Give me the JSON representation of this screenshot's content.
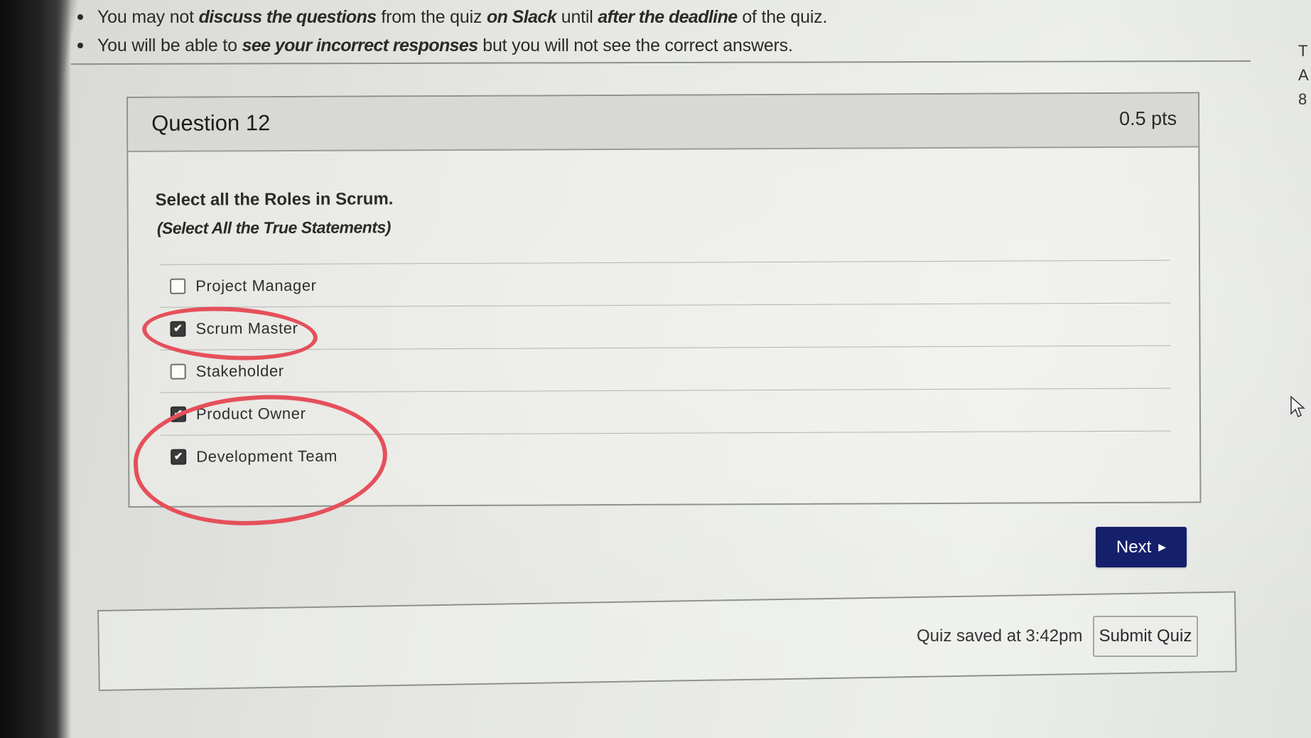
{
  "instructions": [
    {
      "parts": [
        {
          "t": "You may not ",
          "em": false
        },
        {
          "t": "discuss the questions",
          "em": true
        },
        {
          "t": " from the quiz ",
          "em": false
        },
        {
          "t": "on Slack",
          "em": true
        },
        {
          "t": " until ",
          "em": false
        },
        {
          "t": "after the deadline",
          "em": true
        },
        {
          "t": " of the quiz.",
          "em": false
        }
      ]
    },
    {
      "parts": [
        {
          "t": "You will be able to ",
          "em": false
        },
        {
          "t": "see your incorrect responses",
          "em": true
        },
        {
          "t": " but you will not see the correct answers.",
          "em": false
        }
      ]
    }
  ],
  "question": {
    "title": "Question 12",
    "points": "0.5 pts",
    "text": "Select all the Roles in Scrum.",
    "note": "(Select All the True Statements)",
    "answers": [
      {
        "label": "Project Manager",
        "checked": false
      },
      {
        "label": "Scrum Master",
        "checked": true
      },
      {
        "label": "Stakeholder",
        "checked": false
      },
      {
        "label": "Product Owner",
        "checked": true
      },
      {
        "label": "Development Team",
        "checked": true
      }
    ]
  },
  "navigation": {
    "next_label": "Next",
    "next_icon": "triangle-right-icon"
  },
  "footer": {
    "saved_text": "Quiz saved at 3:42pm",
    "submit_label": "Submit Quiz"
  },
  "edge_text": [
    "T",
    "A",
    "8"
  ],
  "annotations": {
    "marker_color": "#e5505a"
  },
  "colors": {
    "next_button": "#14206b"
  }
}
